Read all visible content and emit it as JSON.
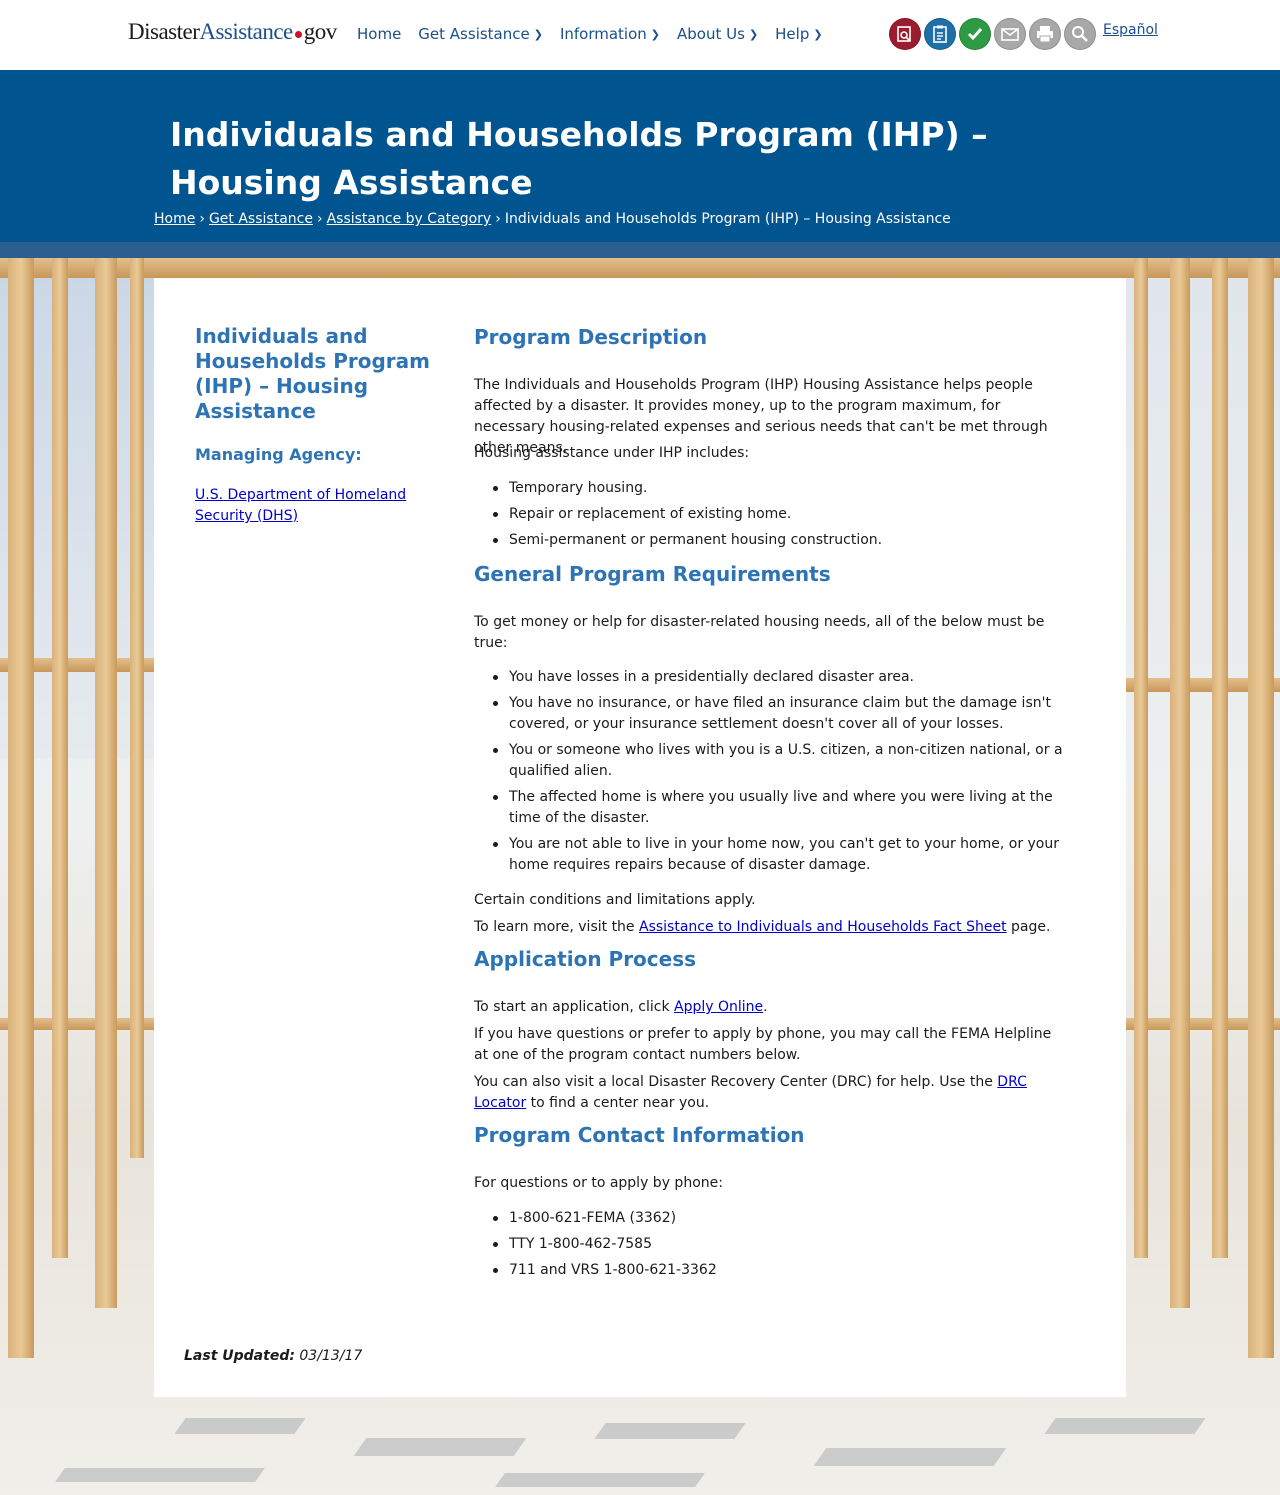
{
  "header": {
    "logo": {
      "part1": "Disaster",
      "part2": "Assistance",
      "part3": "gov"
    },
    "nav": [
      {
        "label": "Home",
        "dropdown": false
      },
      {
        "label": "Get Assistance",
        "dropdown": true
      },
      {
        "label": "Information",
        "dropdown": true
      },
      {
        "label": "About Us",
        "dropdown": true
      },
      {
        "label": "Help",
        "dropdown": true
      }
    ],
    "tools": [
      {
        "icon": "find-assistance-icon",
        "color": "#9b1c2e"
      },
      {
        "icon": "clipboard-icon",
        "color": "#1f6fa8"
      },
      {
        "icon": "check-icon",
        "color": "#2e9a43"
      },
      {
        "icon": "email-icon",
        "color": "#a8a8a8"
      },
      {
        "icon": "print-icon",
        "color": "#a8a8a8"
      },
      {
        "icon": "search-icon",
        "color": "#a8a8a8"
      }
    ],
    "language_link": "Español"
  },
  "banner": {
    "title": "Individuals and Households Program (IHP) – Housing Assistance",
    "breadcrumb": [
      "Home",
      "Get Assistance",
      "Assistance by Category",
      "Individuals and Households Program (IHP) – Housing Assistance"
    ]
  },
  "sidebar": {
    "title": "Individuals and Households Program (IHP) – Housing Assistance",
    "agency_label": "Managing Agency:",
    "agency_link": "U.S. Department of Homeland Security (DHS)"
  },
  "main": {
    "program_description": {
      "heading": "Program Description",
      "para1": "The Individuals and Households Program (IHP) Housing Assistance helps people affected by a disaster. It provides money, up to the program maximum, for necessary housing-related expenses and serious needs that can't be met through other means.",
      "para2": "Housing assistance under IHP includes:",
      "items": [
        "Temporary housing.",
        "Repair or replacement of existing home.",
        "Semi-permanent or permanent housing construction."
      ]
    },
    "requirements": {
      "heading": "General Program Requirements",
      "intro": "To get money or help for disaster-related housing needs, all of the below must be true:",
      "items": [
        "You have losses in a presidentially declared disaster area.",
        "You have no insurance, or have filed an insurance claim but the damage isn't covered, or your insurance settlement doesn't cover all of your losses.",
        "You or someone who lives with you is a U.S. citizen, a non-citizen national, or a qualified alien.",
        "The affected home is where you usually live and where you were living at the time of the disaster.",
        "You are not able to live in your home now, you can't get to your home, or your home requires repairs because of disaster damage."
      ],
      "conditions": "Certain conditions and limitations apply.",
      "learn_more_prefix": "To learn more, visit the ",
      "learn_more_link": "Assistance to Individuals and Households Fact Sheet",
      "learn_more_suffix": " page."
    },
    "application": {
      "heading": "Application Process",
      "start_prefix": "To start an application, click ",
      "start_link": "Apply Online",
      "start_suffix": ".",
      "phone": "If you have questions or prefer to apply by phone, you may call the FEMA Helpline at one of the program contact numbers below.",
      "drc_prefix": "You can also visit a local Disaster Recovery Center (DRC) for help. Use the ",
      "drc_link": "DRC Locator",
      "drc_suffix": " to find a center near you."
    },
    "contact": {
      "heading": "Program Contact Information",
      "intro": "For questions or to apply by phone:",
      "items": [
        "1-800-621-FEMA (3362)",
        "TTY 1-800-462-7585",
        "711 and VRS 1-800-621-3362"
      ]
    }
  },
  "footer": {
    "last_updated_label": "Last Updated:",
    "last_updated_value": "03/13/17"
  }
}
